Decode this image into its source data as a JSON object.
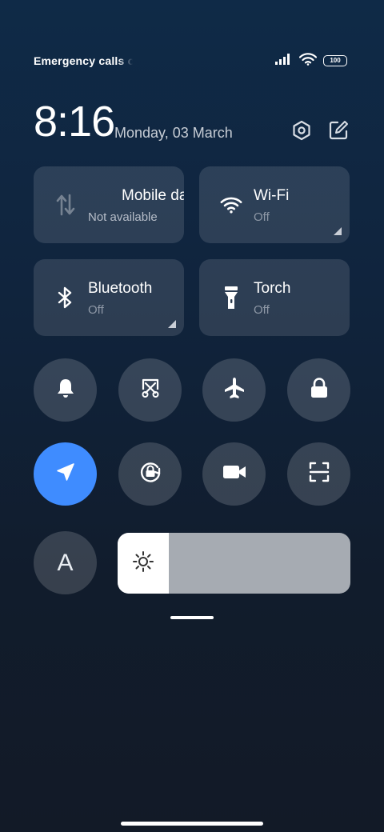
{
  "status_bar": {
    "carrier_text": "Emergency calls only",
    "battery_level": "100",
    "signal": "signal-bars-icon",
    "wifi": "wifi-icon"
  },
  "header": {
    "time": "8:16",
    "date": "Monday, 03 March",
    "icons": [
      "settings-icon",
      "edit-icon"
    ]
  },
  "tiles": {
    "mobile_data": {
      "title": "Mobile data",
      "status": "Not available",
      "icon": "mobile-data-icon"
    },
    "wifi": {
      "title": "Wi-Fi",
      "status": "Off",
      "icon": "wifi-icon"
    },
    "bluetooth": {
      "title": "Bluetooth",
      "status": "Off",
      "icon": "bluetooth-icon"
    },
    "torch": {
      "title": "Torch",
      "status": "Off",
      "icon": "flashlight-icon"
    }
  },
  "toggles": [
    {
      "name": "bell-icon",
      "active": false
    },
    {
      "name": "screenshot-icon",
      "active": false
    },
    {
      "name": "airplane-icon",
      "active": false
    },
    {
      "name": "lock-icon",
      "active": false
    },
    {
      "name": "location-icon",
      "active": true
    },
    {
      "name": "rotation-lock-icon",
      "active": false
    },
    {
      "name": "video-camera-icon",
      "active": false
    },
    {
      "name": "scan-icon",
      "active": false
    }
  ],
  "auto_brightness": {
    "label": "A",
    "active": false
  },
  "brightness": {
    "level": 0.22,
    "icon": "sun-icon"
  },
  "colors": {
    "accent": "#3f8cff",
    "tile_bg": "rgba(255,255,255,0.12)",
    "slider_track": "#a6abb2"
  }
}
